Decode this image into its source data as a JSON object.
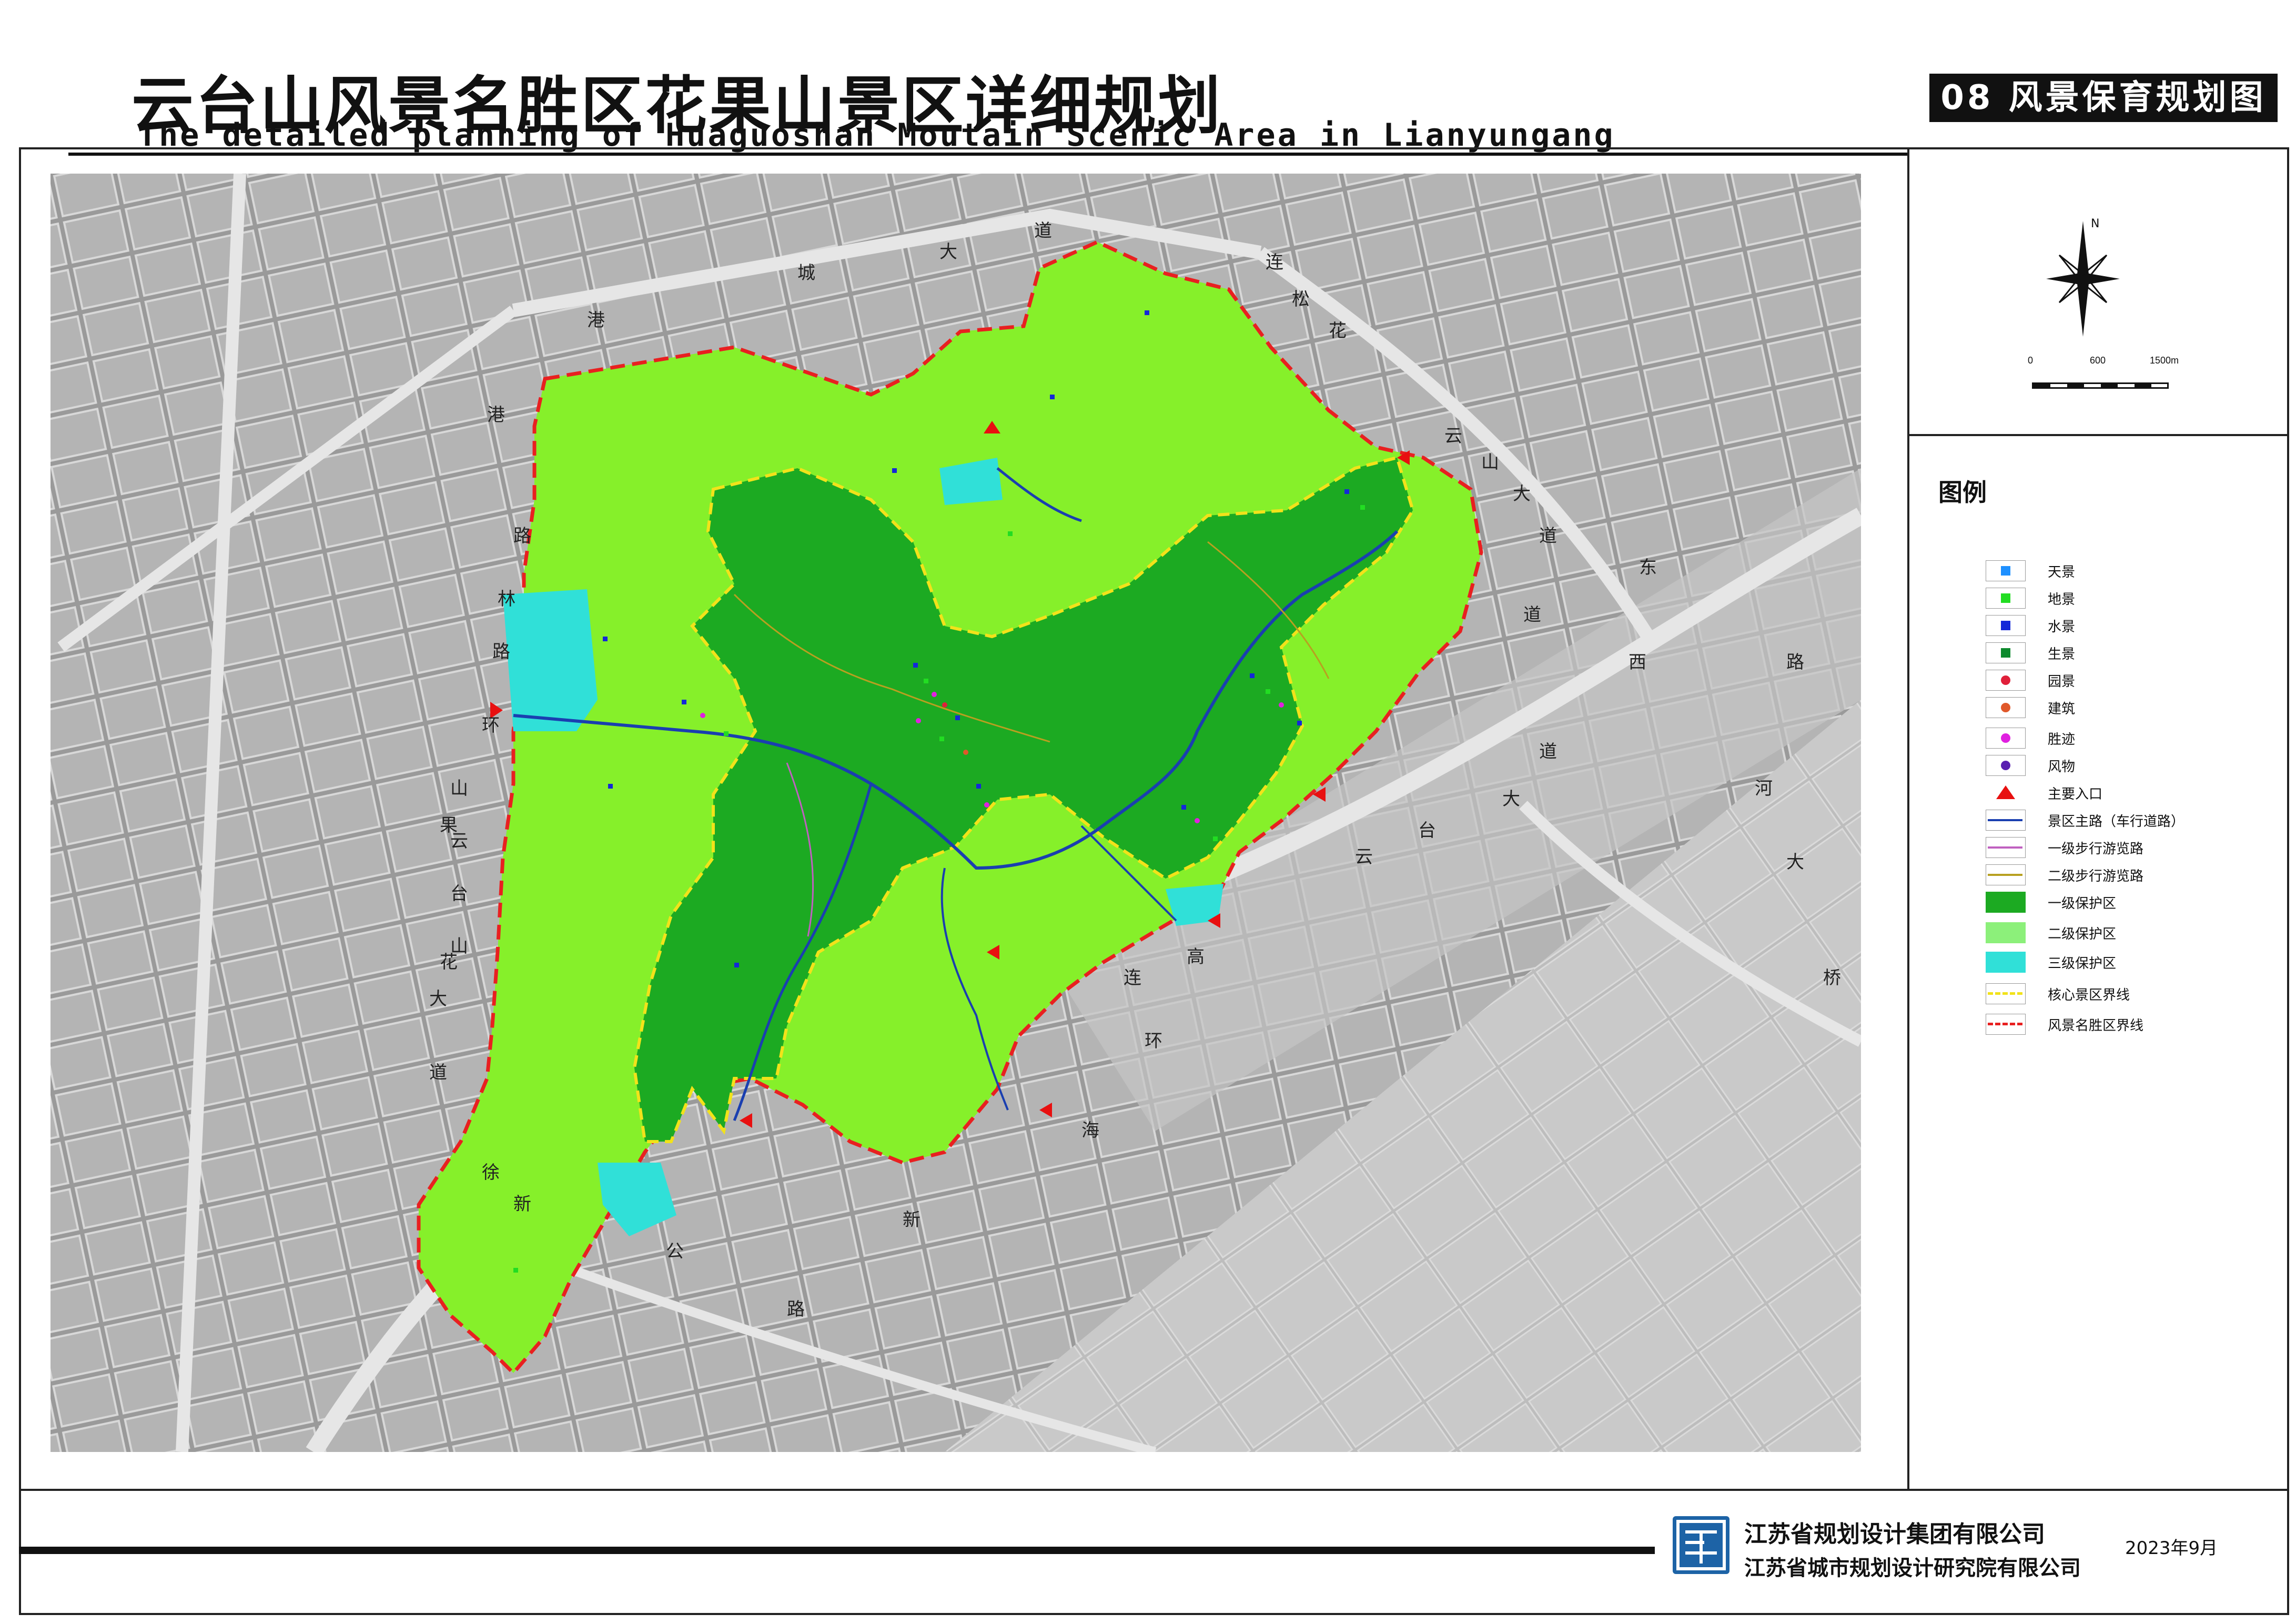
{
  "title_cn": "云台山风景名胜区花果山景区详细规划",
  "title_en": "The detailed planning of Huaguoshan Moutain Scenic Area in Lianyungang",
  "sheet_title": "08 风景保育规划图",
  "north_label": "N",
  "scale_ticks": [
    "0",
    "600",
    "1500m"
  ],
  "legend_title": "图例",
  "legend": [
    {
      "label": "天景",
      "symbol": "square",
      "color": "#1e90ff"
    },
    {
      "label": "地景",
      "symbol": "square",
      "color": "#22dd22"
    },
    {
      "label": "水景",
      "symbol": "square",
      "color": "#1428d8"
    },
    {
      "label": "生景",
      "symbol": "square",
      "color": "#0e8a2e"
    },
    {
      "label": "园景",
      "symbol": "dot",
      "color": "#e0203a"
    },
    {
      "label": "建筑",
      "symbol": "dot",
      "color": "#e0582a"
    },
    {
      "label": "胜迹",
      "symbol": "dot",
      "color": "#e020e0"
    },
    {
      "label": "风物",
      "symbol": "dot",
      "color": "#5a20b0"
    },
    {
      "label": "主要入口",
      "symbol": "triangle",
      "color": "#e81010"
    },
    {
      "label": "景区主路（车行道路）",
      "symbol": "line",
      "color": "#1a3fb0"
    },
    {
      "label": "一级步行游览路",
      "symbol": "line",
      "color": "#c060c0"
    },
    {
      "label": "二级步行游览路",
      "symbol": "line",
      "color": "#b8a020"
    },
    {
      "label": "一级保护区",
      "symbol": "fill",
      "color": "#1caa22"
    },
    {
      "label": "二级保护区",
      "symbol": "fill",
      "color": "#8cf07a"
    },
    {
      "label": "三级保护区",
      "symbol": "fill",
      "color": "#30e0d8"
    },
    {
      "label": "核心景区界线",
      "symbol": "dashed",
      "color": "#f2e21a"
    },
    {
      "label": "风景名胜区界线",
      "symbol": "dashed",
      "color": "#e82020"
    }
  ],
  "map": {
    "road_labels": [
      "城",
      "大",
      "道",
      "港",
      "花",
      "松",
      "连",
      "云",
      "山",
      "大",
      "道",
      "港",
      "路",
      "林",
      "路",
      "环",
      "山",
      "云",
      "台",
      "山",
      "果",
      "花",
      "大",
      "道",
      "徐",
      "新",
      "公",
      "路",
      "新",
      "海",
      "连",
      "高",
      "环",
      "云",
      "台",
      "大",
      "道",
      "东",
      "路",
      "河",
      "大",
      "桥",
      "西",
      "道"
    ]
  },
  "org_1": "江苏省规划设计集团有限公司",
  "org_2": "江苏省城市规划设计研究院有限公司",
  "date": "2023年9月",
  "colors": {
    "zone1": "#1caa22",
    "zone2": "#86f02a",
    "zone3": "#30e0d8",
    "boundary": "#e82020",
    "core": "#f2e21a"
  }
}
